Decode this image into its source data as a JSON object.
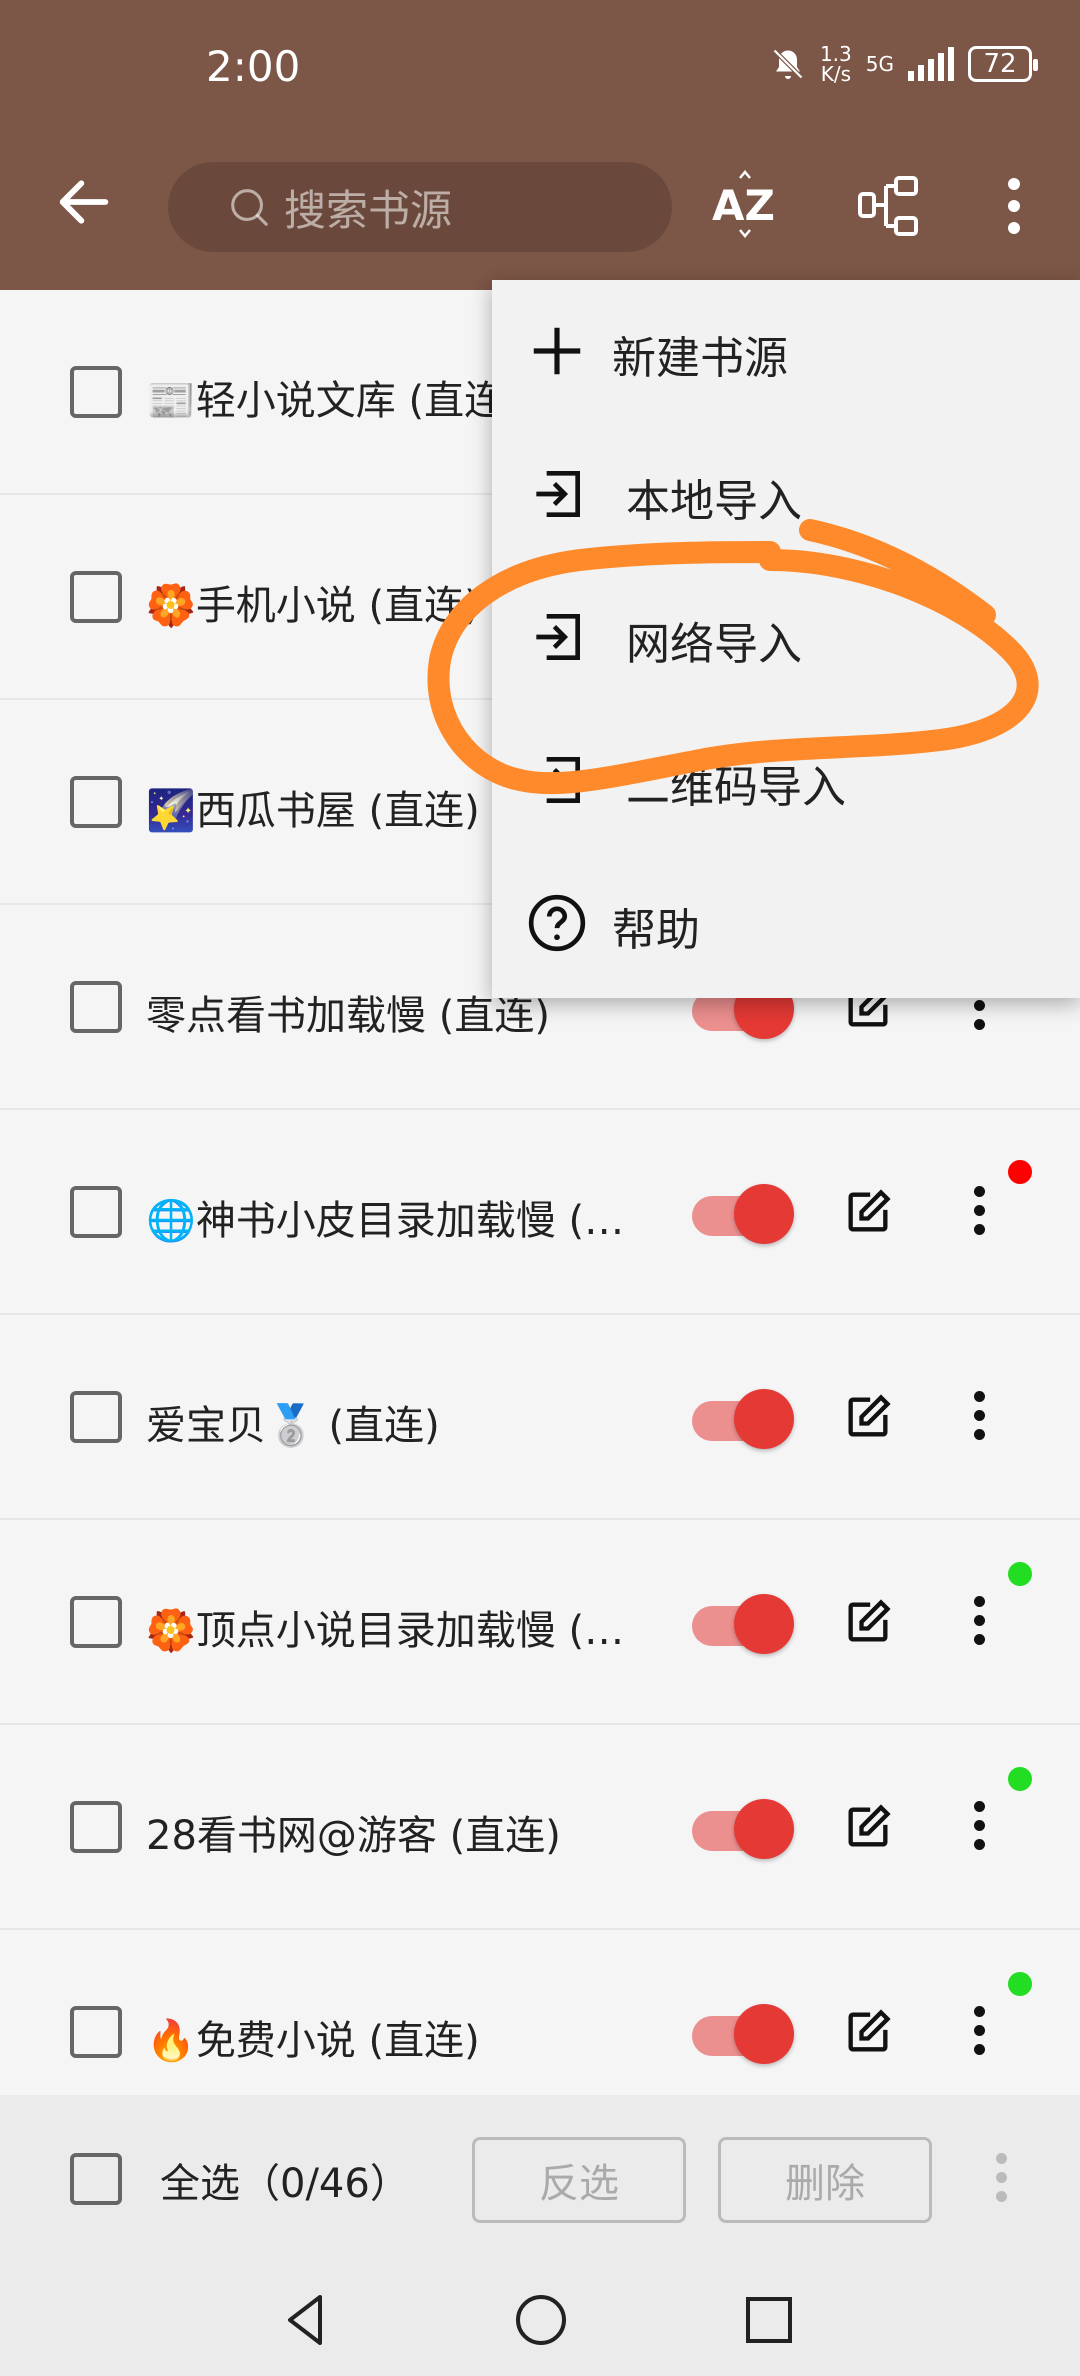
{
  "status_bar": {
    "time": "2:00",
    "net_speed_value": "1.3",
    "net_speed_unit": "K/s",
    "signal": "5G",
    "battery": "72",
    "mute_icon": "bell-off-icon"
  },
  "app_bar": {
    "back_icon": "arrow-left-icon",
    "search_placeholder": "搜索书源",
    "sort_label": "AZ",
    "group_icon": "tree-icon",
    "more_icon": "more-vertical-icon",
    "bg_color": "#7c5646"
  },
  "sources": [
    {
      "emoji": "📰",
      "title": "轻小说文库 (直连)",
      "enabled": true,
      "dot": null
    },
    {
      "emoji": "🏵️",
      "title": "手机小说 (直连)",
      "enabled": true,
      "dot": null
    },
    {
      "emoji": "🌠",
      "title": "西瓜书屋 (直连)",
      "enabled": true,
      "dot": null
    },
    {
      "emoji": "",
      "title": "零点看书加载慢 (直连)",
      "enabled": true,
      "dot": null
    },
    {
      "emoji": "🌐",
      "title": "神书小皮目录加载慢 (…",
      "enabled": true,
      "dot": "#ff0000"
    },
    {
      "emoji": "",
      "title": "爱宝贝🥈 (直连)",
      "enabled": true,
      "dot": null
    },
    {
      "emoji": "🏵️",
      "title": "顶点小说目录加载慢 (…",
      "enabled": true,
      "dot": "#22dd22"
    },
    {
      "emoji": "",
      "title": "28看书网@游客 (直连)",
      "enabled": true,
      "dot": "#22dd22"
    },
    {
      "emoji": "🔥",
      "title": "免费小说 (直连)",
      "enabled": true,
      "dot": "#22dd22"
    }
  ],
  "popup_menu": {
    "items": [
      {
        "icon": "plus-icon",
        "label": "新建书源"
      },
      {
        "icon": "import-icon",
        "label": "本地导入"
      },
      {
        "icon": "import-icon",
        "label": "网络导入"
      },
      {
        "icon": "import-icon",
        "label": "二维码导入"
      },
      {
        "icon": "help-circle-icon",
        "label": "帮助"
      }
    ]
  },
  "bottom_bar": {
    "select_all": "全选（0/46）",
    "invert_label": "反选",
    "delete_label": "删除"
  },
  "nav_bar": {
    "back_icon": "triangle-back-icon",
    "home_icon": "circle-home-icon",
    "recents_icon": "square-recents-icon"
  },
  "colors": {
    "toggle_on": "#e53935",
    "toggle_track": "#ec8f8f",
    "annotation_stroke": "#ff8a2b"
  }
}
